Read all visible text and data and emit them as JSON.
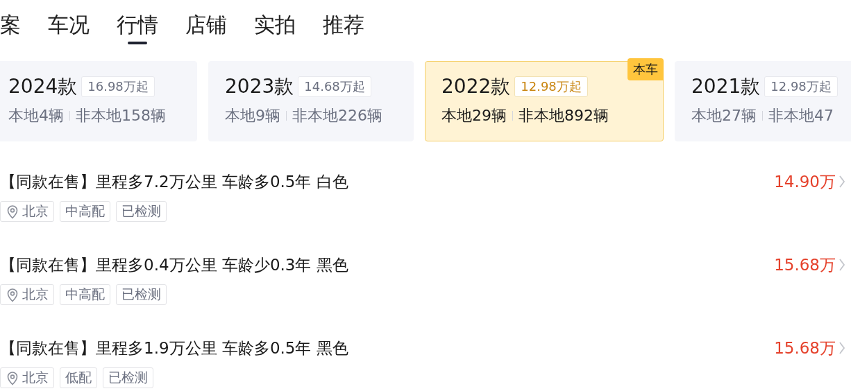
{
  "tabs": [
    {
      "label": "案",
      "selected": false
    },
    {
      "label": "车况",
      "selected": false
    },
    {
      "label": "行情",
      "selected": true
    },
    {
      "label": "店铺",
      "selected": false
    },
    {
      "label": "实拍",
      "selected": false
    },
    {
      "label": "推荐",
      "selected": false
    }
  ],
  "versions": [
    {
      "year": "2024款",
      "price": "16.98万起",
      "local": "本地4辆",
      "nonlocal": "非本地158辆",
      "selected": false
    },
    {
      "year": "2023款",
      "price": "14.68万起",
      "local": "本地9辆",
      "nonlocal": "非本地226辆",
      "selected": false
    },
    {
      "year": "2022款",
      "price": "12.98万起",
      "local": "本地29辆",
      "nonlocal": "非本地892辆",
      "selected": true,
      "badge": "本车"
    },
    {
      "year": "2021款",
      "price": "12.98万起",
      "local": "本地27辆",
      "nonlocal": "非本地47",
      "selected": false
    }
  ],
  "listings": [
    {
      "title": "【同款在售】里程多7.2万公里 车龄多0.5年 白色",
      "price": "14.90万",
      "tags": [
        {
          "kind": "location",
          "label": "北京"
        },
        {
          "kind": "plain",
          "label": "中高配"
        },
        {
          "kind": "plain",
          "label": "已检测"
        }
      ]
    },
    {
      "title": "【同款在售】里程多0.4万公里 车龄少0.3年 黑色",
      "price": "15.68万",
      "tags": [
        {
          "kind": "location",
          "label": "北京"
        },
        {
          "kind": "plain",
          "label": "中高配"
        },
        {
          "kind": "plain",
          "label": "已检测"
        }
      ]
    },
    {
      "title": "【同款在售】里程多1.9万公里 车龄多0.5年 黑色",
      "price": "15.68万",
      "tags": [
        {
          "kind": "location",
          "label": "北京"
        },
        {
          "kind": "plain",
          "label": "低配"
        },
        {
          "kind": "plain",
          "label": "已检测"
        }
      ]
    }
  ]
}
